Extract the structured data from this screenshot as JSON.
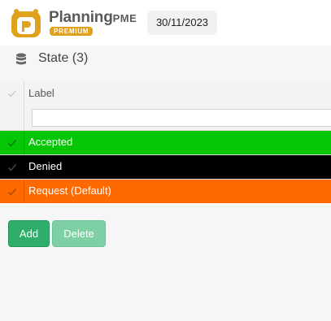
{
  "header": {
    "brand_name": "Planning",
    "brand_suffix": "PME",
    "badge": "PREMIUM",
    "date": "30/11/2023"
  },
  "section": {
    "icon": "database-icon",
    "title": "State (3)"
  },
  "grid": {
    "columns": [
      "Label"
    ],
    "filter_placeholder": "",
    "rows": [
      {
        "label": "Accepted",
        "color": "#05c605"
      },
      {
        "label": "Denied",
        "color": "#000000"
      },
      {
        "label": "Request (Default)",
        "color": "#ff6a00"
      }
    ]
  },
  "buttons": {
    "add": "Add",
    "delete": "Delete"
  },
  "colors": {
    "accent": "#2fae6b",
    "brand_orange": "#e0a21c"
  }
}
